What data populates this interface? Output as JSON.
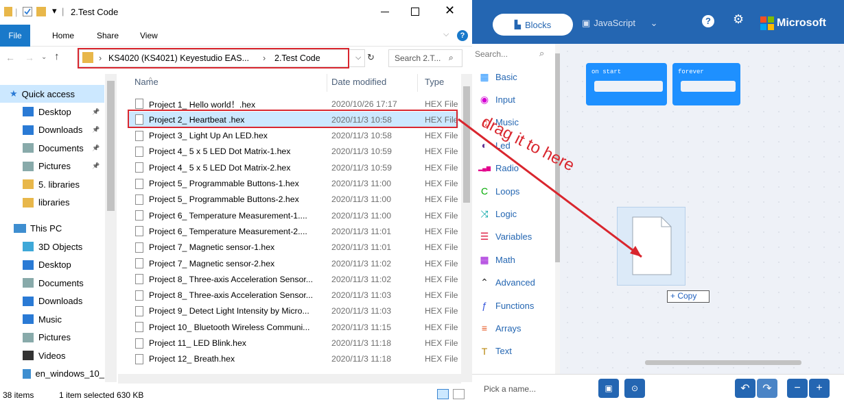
{
  "explorer": {
    "window_title": "2.Test Code",
    "ribbon_tabs": [
      "File",
      "Home",
      "Share",
      "View"
    ],
    "address": {
      "crumb1": "KS4020  (KS4021)  Keyestudio EAS...",
      "crumb2": "2.Test Code"
    },
    "search_placeholder": "Search 2.T...",
    "nav": {
      "quick_access": "Quick access",
      "quick_items": [
        "Desktop",
        "Downloads",
        "Documents",
        "Pictures",
        "5. libraries",
        "libraries"
      ],
      "this_pc": "This PC",
      "pc_items": [
        "3D Objects",
        "Desktop",
        "Documents",
        "Downloads",
        "Music",
        "Pictures",
        "Videos",
        "en_windows_10_"
      ]
    },
    "columns": {
      "name": "Name",
      "date": "Date modified",
      "type": "Type"
    },
    "files": [
      {
        "name": "Project 1_ Hello world！.hex",
        "date": "2020/10/26 17:17",
        "type": "HEX File"
      },
      {
        "name": "Project 2_ Heartbeat .hex",
        "date": "2020/11/3 10:58",
        "type": "HEX File"
      },
      {
        "name": "Project 3_ Light Up An LED.hex",
        "date": "2020/11/3 10:58",
        "type": "HEX File"
      },
      {
        "name": "Project 4_ 5 x 5 LED Dot Matrix-1.hex",
        "date": "2020/11/3 10:59",
        "type": "HEX File"
      },
      {
        "name": "Project 4_ 5 x 5 LED Dot Matrix-2.hex",
        "date": "2020/11/3 10:59",
        "type": "HEX File"
      },
      {
        "name": "Project 5_ Programmable Buttons-1.hex",
        "date": "2020/11/3 11:00",
        "type": "HEX File"
      },
      {
        "name": "Project 5_ Programmable Buttons-2.hex",
        "date": "2020/11/3 11:00",
        "type": "HEX File"
      },
      {
        "name": "Project 6_ Temperature Measurement-1....",
        "date": "2020/11/3 11:00",
        "type": "HEX File"
      },
      {
        "name": "Project 6_ Temperature Measurement-2....",
        "date": "2020/11/3 11:01",
        "type": "HEX File"
      },
      {
        "name": "Project 7_ Magnetic sensor-1.hex",
        "date": "2020/11/3 11:01",
        "type": "HEX File"
      },
      {
        "name": "Project 7_ Magnetic sensor-2.hex",
        "date": "2020/11/3 11:02",
        "type": "HEX File"
      },
      {
        "name": "Project 8_ Three-axis Acceleration Sensor...",
        "date": "2020/11/3 11:02",
        "type": "HEX File"
      },
      {
        "name": "Project 8_ Three-axis Acceleration Sensor...",
        "date": "2020/11/3 11:03",
        "type": "HEX File"
      },
      {
        "name": "Project 9_ Detect Light Intensity by Micro...",
        "date": "2020/11/3 11:03",
        "type": "HEX File"
      },
      {
        "name": "Project 10_ Bluetooth Wireless Communi...",
        "date": "2020/11/3 11:15",
        "type": "HEX File"
      },
      {
        "name": "Project 11_ LED Blink.hex",
        "date": "2020/11/3 11:18",
        "type": "HEX File"
      },
      {
        "name": "Project 12_ Breath.hex",
        "date": "2020/11/3 11:18",
        "type": "HEX File"
      }
    ],
    "status": {
      "count": "38 items",
      "selected": "1 item selected  630 KB"
    }
  },
  "makecode": {
    "tabs": {
      "blocks": "Blocks",
      "javascript": "JavaScript"
    },
    "brand": "Microsoft",
    "search_placeholder": "Search...",
    "categories": [
      {
        "label": "Basic",
        "icon": "grid-icon",
        "color": "#1e90ff"
      },
      {
        "label": "Input",
        "icon": "input-icon",
        "color": "#d400d4"
      },
      {
        "label": "Music",
        "icon": "headphones-icon",
        "color": "#e63022"
      },
      {
        "label": "Led",
        "icon": "toggle-icon",
        "color": "#5c2d91"
      },
      {
        "label": "Radio",
        "icon": "signal-icon",
        "color": "#e3008c"
      },
      {
        "label": "Loops",
        "icon": "loop-icon",
        "color": "#00aa00"
      },
      {
        "label": "Logic",
        "icon": "shuffle-icon",
        "color": "#00a4a6"
      },
      {
        "label": "Variables",
        "icon": "list-icon",
        "color": "#dc143c"
      },
      {
        "label": "Math",
        "icon": "calculator-icon",
        "color": "#9400d3"
      },
      {
        "label": "Advanced",
        "icon": "chevron-up-icon",
        "color": "#222222"
      },
      {
        "label": "Functions",
        "icon": "function-icon",
        "color": "#3455db"
      },
      {
        "label": "Arrays",
        "icon": "array-icon",
        "color": "#e65722"
      },
      {
        "label": "Text",
        "icon": "text-icon",
        "color": "#b8860b"
      }
    ],
    "blocks": {
      "on_start": "on start",
      "forever": "forever"
    },
    "copy_label": "+ Copy",
    "project_name_placeholder": "Pick a name...",
    "annotation": "drag it to here"
  }
}
